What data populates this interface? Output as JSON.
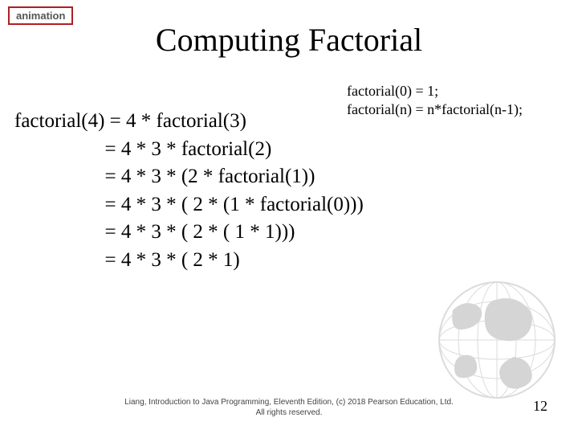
{
  "badge": {
    "label": "animation"
  },
  "title": "Computing Factorial",
  "rules": {
    "line1": "factorial(0) = 1;",
    "line2": "factorial(n) = n*factorial(n-1);"
  },
  "steps": {
    "line1": "factorial(4) = 4 * factorial(3)",
    "line2": "                  = 4 * 3 * factorial(2)",
    "line3": "                  = 4 * 3 * (2 * factorial(1))",
    "line4": "                  = 4 * 3 * ( 2 * (1 * factorial(0)))",
    "line5": "                  = 4 * 3 * ( 2 * ( 1 * 1)))",
    "line6": "                  = 4 * 3 * ( 2 * 1)"
  },
  "footer": {
    "line1": "Liang, Introduction to Java Programming, Eleventh Edition, (c) 2018 Pearson Education, Ltd.",
    "line2": "All rights reserved."
  },
  "page_number": "12"
}
